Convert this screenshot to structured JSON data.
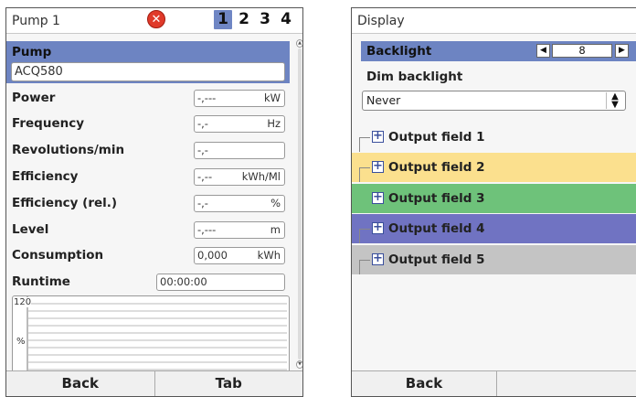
{
  "left_panel": {
    "title": "Pump 1",
    "error_icon": "error-x-icon",
    "tabs": [
      "1",
      "2",
      "3",
      "4"
    ],
    "active_tab": "1",
    "pump_section": {
      "label": "Pump",
      "value": "ACQ580"
    },
    "rows": [
      {
        "label": "Power",
        "value": "-,---",
        "unit": "kW"
      },
      {
        "label": "Frequency",
        "value": "-,-",
        "unit": "Hz"
      },
      {
        "label": "Revolutions/min",
        "value": "-,-",
        "unit": ""
      },
      {
        "label": "Efficiency",
        "value": "-,--",
        "unit": "kWh/Ml"
      },
      {
        "label": "Efficiency (rel.)",
        "value": "-,-",
        "unit": "%"
      },
      {
        "label": "Level",
        "value": "-,---",
        "unit": "m"
      },
      {
        "label": "Consumption",
        "value": "0,000",
        "unit": "kWh"
      }
    ],
    "runtime": {
      "label": "Runtime",
      "value": "00:00:00"
    },
    "chart": {
      "y_max_label": "120",
      "unit_label": "%"
    },
    "softkeys": [
      "Back",
      "Tab"
    ]
  },
  "right_panel": {
    "title": "Display",
    "backlight": {
      "label": "Backlight",
      "value": "8"
    },
    "dim_backlight": {
      "label": "Dim backlight",
      "value": "Never"
    },
    "output_fields": [
      {
        "label": "Output field 1",
        "color": "#f6f6f6"
      },
      {
        "label": "Output field 2",
        "color": "#fbe08e"
      },
      {
        "label": "Output field 3",
        "color": "#6ec27a"
      },
      {
        "label": "Output field 4",
        "color": "#7073c2"
      },
      {
        "label": "Output field 5",
        "color": "#c4c4c4"
      }
    ],
    "softkeys": [
      "Back",
      ""
    ]
  },
  "colors": {
    "selection": "#6d84c2",
    "error": "#e03a2a"
  }
}
